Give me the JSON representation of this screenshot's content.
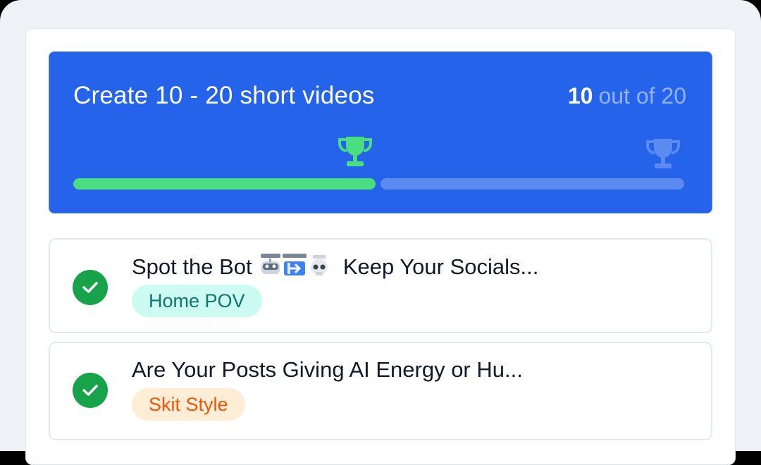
{
  "goal": {
    "title": "Create 10 - 20 short videos",
    "progress_current": "10",
    "progress_rest": "out of 20",
    "progress_fraction": 0.5,
    "colors": {
      "panel": "#2563eb",
      "bar_done": "#4ade80",
      "bar_rest": "#5b8af0",
      "trophy_reached": "#4ade80",
      "trophy_pending": "#5b8af0"
    }
  },
  "tasks": [
    {
      "title_prefix": "Spot the Bot",
      "title_suffix": "Keep Your Socials...",
      "icons": [
        "robot-emoji",
        "arrow-emoji",
        "skull-emoji"
      ],
      "status": "check-icon",
      "tag": "Home POV",
      "tag_color": "#0f766e"
    },
    {
      "title": "Are Your Posts Giving AI Energy or Hu...",
      "status": "check-icon",
      "tag": "Skit Style",
      "tag_color": "#ea580c"
    }
  ]
}
